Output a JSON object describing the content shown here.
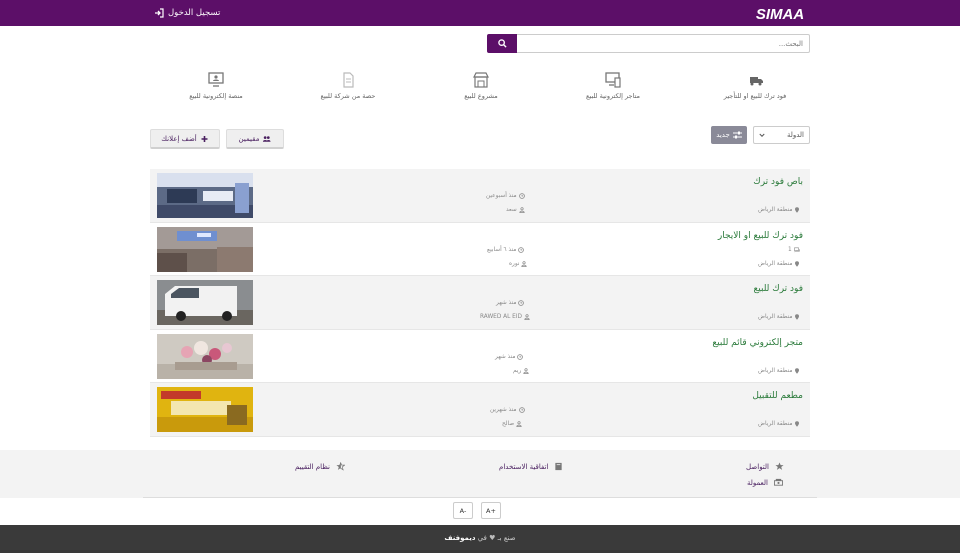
{
  "header": {
    "logo_text": "SIMAA",
    "login_label": "تسجيل الدخول",
    "bg_color": "#5c0f68"
  },
  "search": {
    "placeholder": "البحث...",
    "button_icon": "search-icon"
  },
  "categories": [
    {
      "label": "فود ترك للبيع او للتأجير",
      "icon": "truck-icon"
    },
    {
      "label": "متاجر إلكترونية للبيع",
      "icon": "devices-icon"
    },
    {
      "label": "مشروع للبيع",
      "icon": "store-icon"
    },
    {
      "label": "حصة من شركة للبيع",
      "icon": "document-icon"
    },
    {
      "label": "منصة إلكترونية للبيع",
      "icon": "monitor-user-icon"
    }
  ],
  "filters": {
    "country_label": "الدولة",
    "new_label": "جديد",
    "residents_label": "مقيمين",
    "add_ad_label": "أضف إعلانك"
  },
  "listings": [
    {
      "title": "باص فود ترك",
      "time": "منذ أسبوعين",
      "user": "سعد",
      "location": "منطقة الرياض",
      "count": ""
    },
    {
      "title": "فود ترك للبيع او الايجار",
      "time": "منذ ٦ أسابيع",
      "user": "نوره",
      "location": "منطقة الرياض",
      "count": "1"
    },
    {
      "title": "فود ترك للبيع",
      "time": "منذ شهر",
      "user": "RAWED AL EID",
      "location": "منطقة الرياض",
      "count": ""
    },
    {
      "title": "متجر إلكتروني قائم للبيع",
      "time": "منذ شهر",
      "user": "ريم",
      "location": "منطقة الرياض",
      "count": ""
    },
    {
      "title": "مطعم للتقبيل",
      "time": "منذ شهرين",
      "user": "صالح",
      "location": "منطقة الرياض",
      "count": ""
    }
  ],
  "footer": {
    "contact": "التواصل",
    "funding": "العمولة",
    "terms": "اتفاقية الاستخدام",
    "rating": "نظام التقييم",
    "font_minus": "A-",
    "font_plus": "A+",
    "made_prefix": "صنع بـ",
    "made_in": "في",
    "made_by": "ديموفنف"
  }
}
